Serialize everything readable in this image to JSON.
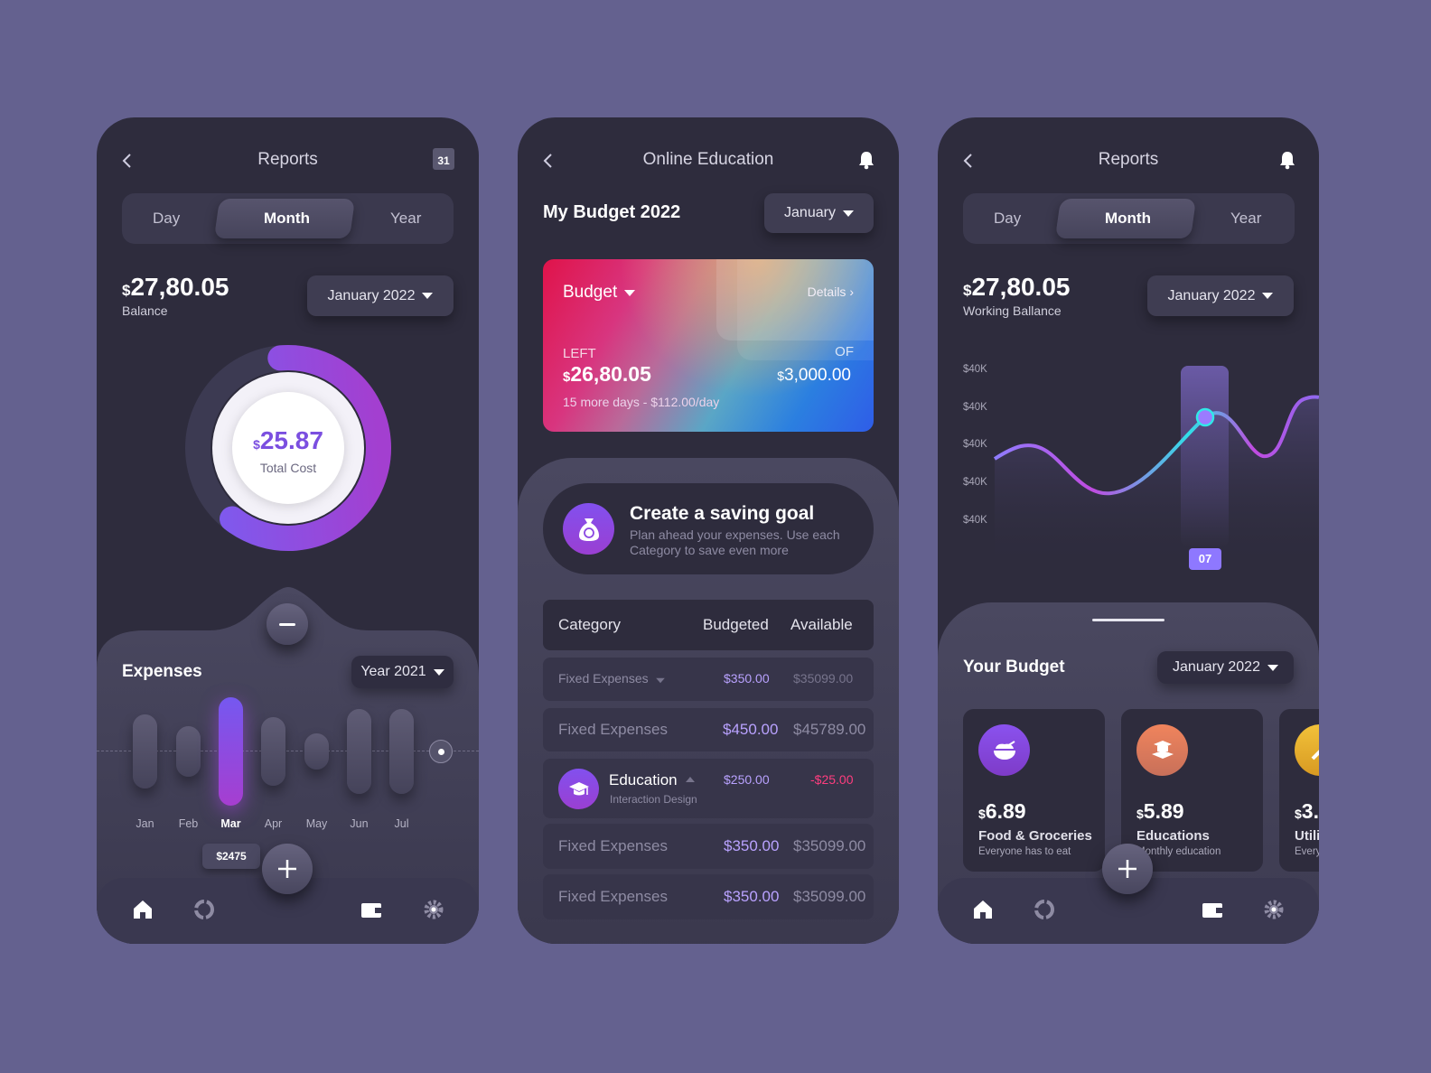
{
  "colors": {
    "background": "#64618f",
    "phone": "#2e2c3d",
    "accent": "#8b5cf6",
    "negative": "#ff3d7f",
    "budgeted": "#b9a2ff"
  },
  "left": {
    "title": "Reports",
    "calendar_day": "31",
    "segments": [
      "Day",
      "Month",
      "Year"
    ],
    "active_segment": "Month",
    "balance_currency": "$",
    "balance": "27,80.05",
    "balance_label": "Balance",
    "period": "January 2022",
    "donut": {
      "currency": "$",
      "value": "25.87",
      "label": "Total Cost",
      "progress": 0.62
    },
    "expenses": {
      "title": "Expenses",
      "period": "Year 2021",
      "months": [
        "Jan",
        "Feb",
        "Mar",
        "Apr",
        "May",
        "Jun",
        "Jul"
      ],
      "levels": [
        0.69,
        0.47,
        1.0,
        0.64,
        0.34,
        0.78,
        0.78
      ],
      "selected": "Mar",
      "tooltip": "$2475"
    },
    "nav": [
      "home-icon",
      "chart-icon",
      "wallet-icon",
      "settings-icon"
    ]
  },
  "middle": {
    "title": "Online Education",
    "budget_title": "My Budget 2022",
    "month": "January",
    "card": {
      "label": "Budget",
      "details": "Details",
      "left_label": "LEFT",
      "left_currency": "$",
      "left_value": "26,80.05",
      "of_label": "OF",
      "of_currency": "$",
      "of_value": "3,000.00",
      "days": "15 more days - $112.00/day"
    },
    "goal": {
      "title": "Create a saving goal",
      "text1": "Plan ahead your expenses. Use each",
      "text2": "Category to save even more"
    },
    "table": {
      "headers": [
        "Category",
        "Budgeted",
        "Available"
      ],
      "rows": [
        {
          "category": "Fixed Expenses",
          "budgeted": "$350.00",
          "available": "$35099.00"
        },
        {
          "category": "Fixed Expenses",
          "budgeted": "$450.00",
          "available": "$45789.00"
        },
        {
          "category": "Education",
          "sub": "Interaction Design",
          "budgeted": "$250.00",
          "available": "-$25.00"
        },
        {
          "category": "Fixed Expenses",
          "budgeted": "$350.00",
          "available": "$35099.00"
        },
        {
          "category": "Fixed Expenses",
          "budgeted": "$350.00",
          "available": "$35099.00"
        }
      ]
    }
  },
  "right": {
    "title": "Reports",
    "segments": [
      "Day",
      "Month",
      "Year"
    ],
    "active_segment": "Month",
    "balance_currency": "$",
    "balance": "27,80.05",
    "balance_label": "Working Ballance",
    "period": "January 2022",
    "chart": {
      "type": "line",
      "y_ticks": [
        "$40K",
        "$40K",
        "$40K",
        "$40K",
        "$40K"
      ],
      "highlight_label": "07"
    },
    "budget": {
      "title": "Your Budget",
      "period": "January 2022",
      "cards": [
        {
          "currency": "$",
          "amount": "6.89",
          "name": "Food & Groceries",
          "desc": "Everyone has to eat",
          "color": "#8247e5"
        },
        {
          "currency": "$",
          "amount": "5.89",
          "name": "Educations",
          "desc": "Monthly education",
          "color": "#e8805a"
        },
        {
          "currency": "$",
          "amount": "3.",
          "name": "Utili",
          "desc": "Every",
          "color": "#e8b62a"
        }
      ]
    },
    "nav": [
      "home-icon",
      "chart-icon",
      "wallet-icon",
      "settings-icon"
    ]
  }
}
